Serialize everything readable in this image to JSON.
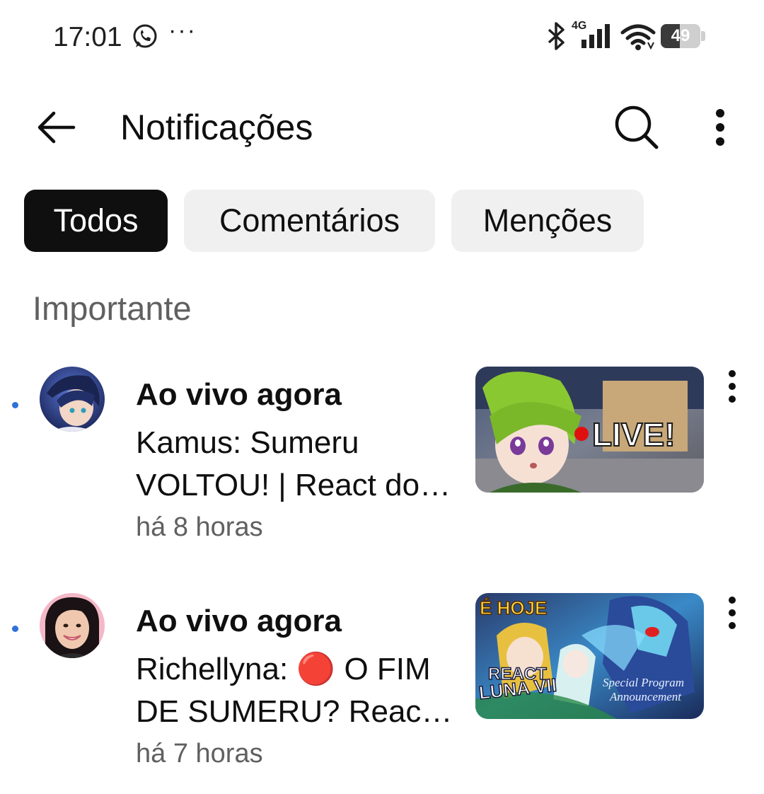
{
  "status_bar": {
    "time": "17:01",
    "more": "···",
    "network": "4G",
    "battery_level": 49,
    "battery_text": "49"
  },
  "app_bar": {
    "title": "Notificações",
    "icons": [
      "back-arrow-icon",
      "search-icon",
      "more-vert-icon"
    ]
  },
  "chips": [
    {
      "label": "Todos",
      "selected": true
    },
    {
      "label": "Comentários",
      "selected": false
    },
    {
      "label": "Menções",
      "selected": false
    }
  ],
  "section": {
    "title": "Importante"
  },
  "notifications": [
    {
      "heading": "Ao vivo agora",
      "body": "Kamus: Sumeru VOLTOU! | React do Luna VII",
      "time": "há 8 horas",
      "unread": true,
      "thumbnail_text": "LIVE!"
    },
    {
      "heading": "Ao vivo agora",
      "body": "Richellyna: 🔴 O FIM DE SUMERU? React Luna VII",
      "time": "há 7 horas",
      "unread": true,
      "thumbnail_text": {
        "top": "É HOJE",
        "react": "REACT",
        "luna": "LUNA VII",
        "special": "Special Program",
        "announcement": "Announcement"
      }
    }
  ],
  "colors": {
    "chip_active_bg": "#0f0f0f",
    "chip_bg": "#f0f0f0",
    "secondary_text": "#606060",
    "unread_dot": "#3070d8"
  }
}
